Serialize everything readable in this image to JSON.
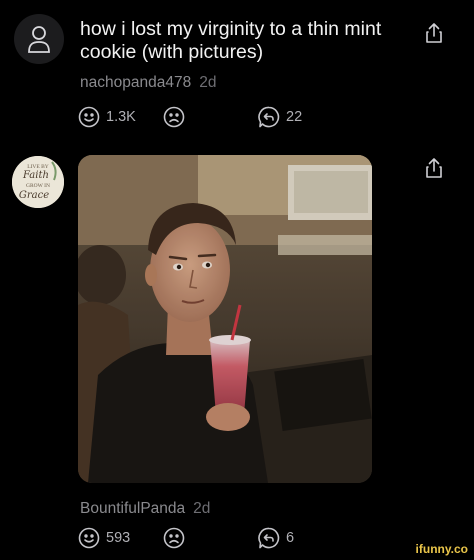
{
  "post": {
    "title": "how i lost my virginity to a thin mint cookie (with pictures)",
    "author": "nachopanda478",
    "age": "2d",
    "likes": "1.3K",
    "comments": "22"
  },
  "reply": {
    "author": "BountifulPanda",
    "age": "2d",
    "likes": "593",
    "comments": "6",
    "avatar_text": [
      "LIVE BY",
      "Faith",
      "GROW IN",
      "Grace"
    ]
  },
  "watermark": "ifunny.co",
  "colors": {
    "background": "#000000",
    "text_primary": "#f2f2f2",
    "text_secondary": "#8a8a8e",
    "watermark": "#e9c54a"
  },
  "icons": [
    "user-icon",
    "share-icon",
    "smile-icon",
    "frown-icon",
    "reply-icon"
  ]
}
